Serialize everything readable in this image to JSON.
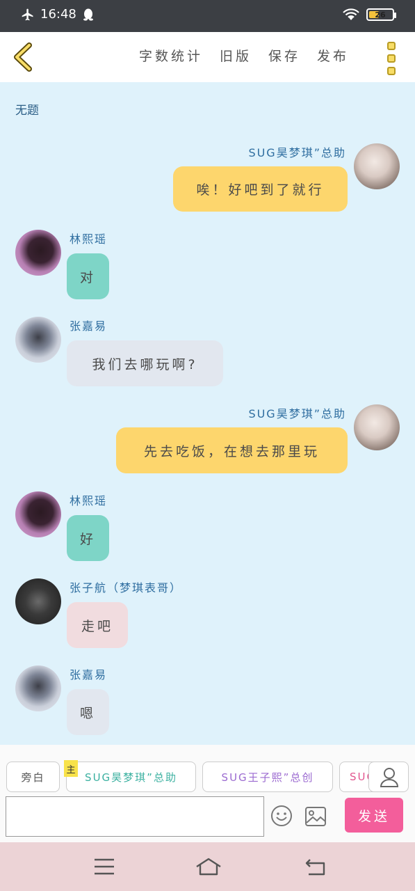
{
  "status": {
    "time": "16:48",
    "battery": "26"
  },
  "toolbar": {
    "actions": [
      "字数统计",
      "旧版",
      "保存",
      "发布"
    ]
  },
  "doc_title": "无题",
  "messages": [
    {
      "side": "right",
      "name": "SUG昊梦琪”总助",
      "text": "唉！好吧到了就行",
      "bubble": "yellow"
    },
    {
      "side": "left",
      "name": "林熙瑶",
      "text": "对",
      "bubble": "teal"
    },
    {
      "side": "left",
      "name": "张嘉易",
      "text": "我们去哪玩啊?",
      "bubble": "grey"
    },
    {
      "side": "right",
      "name": "SUG昊梦琪”总助",
      "text": "先去吃饭，在想去那里玩",
      "bubble": "yellow"
    },
    {
      "side": "left",
      "name": "林熙瑶",
      "text": "好",
      "bubble": "teal"
    },
    {
      "side": "left",
      "name": "张子航（梦琪表哥）",
      "text": "走吧",
      "bubble": "pink"
    },
    {
      "side": "left",
      "name": "张嘉易",
      "text": "嗯",
      "bubble": "grey"
    }
  ],
  "roles": {
    "narration": "旁白",
    "tag": "主",
    "chips": [
      "SUG昊梦琪”总助",
      "SUG王子熙”总创",
      "SUG"
    ]
  },
  "composer": {
    "input_value": "",
    "send_label": "发送"
  },
  "colors": {
    "chat_bg": "#dff2fb",
    "bubble_yellow": "#fdd66d",
    "bubble_teal": "#7ed5c7",
    "bubble_grey": "#e2e7ef",
    "bubble_pink": "#f1dcdf",
    "name_blue": "#2f6ea0",
    "send_pink": "#f35e9b",
    "nav_bg": "#ecd3d6"
  }
}
